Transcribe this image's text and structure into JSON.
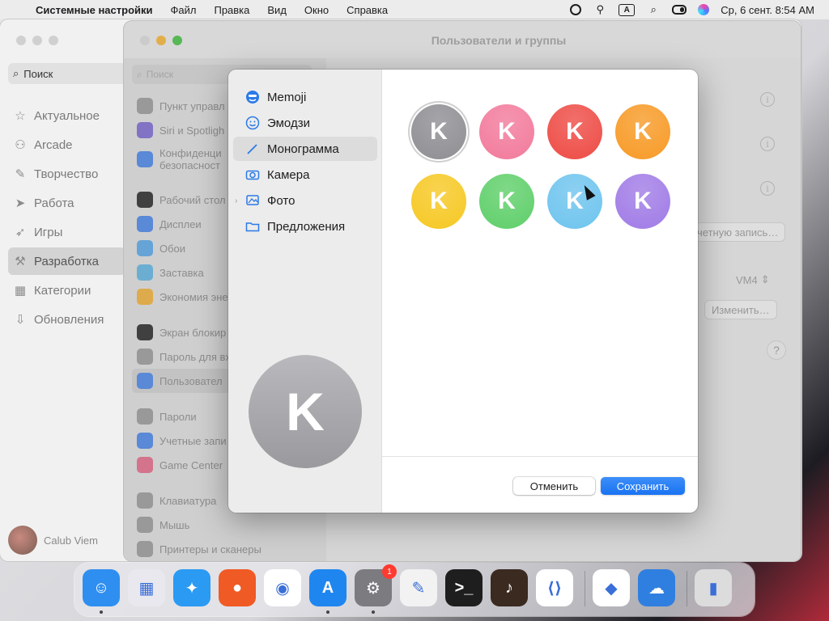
{
  "menubar": {
    "app_name": "Системные настройки",
    "menus": [
      "Файл",
      "Правка",
      "Вид",
      "Окно",
      "Справка"
    ],
    "input_source": "A",
    "clock": "Ср, 6 сент.  8:54 AM"
  },
  "appstore": {
    "search_label": "Поиск",
    "nav": [
      {
        "label": "Актуальное",
        "icon": "star-icon"
      },
      {
        "label": "Arcade",
        "icon": "joystick-icon"
      },
      {
        "label": "Творчество",
        "icon": "brush-icon"
      },
      {
        "label": "Работа",
        "icon": "paper-plane-icon"
      },
      {
        "label": "Игры",
        "icon": "rocket-icon"
      },
      {
        "label": "Разработка",
        "icon": "hammer-icon"
      },
      {
        "label": "Категории",
        "icon": "grid-icon"
      },
      {
        "label": "Обновления",
        "icon": "download-icon"
      }
    ],
    "active_index": 5,
    "user_name": "Calub Viem"
  },
  "settings": {
    "window_title": "Пользователи и группы",
    "search_placeholder": "Поиск",
    "groups": [
      [
        {
          "label": "Пункт управл",
          "color": "#9a9a9a"
        },
        {
          "label": "Siri и Spotligh",
          "color": "#7d6bd1"
        },
        {
          "label": "Конфиденци\nбезопасност",
          "color": "#4a86e8",
          "tall": true
        }
      ],
      [
        {
          "label": "Рабочий стол",
          "color": "#2b2b2b"
        },
        {
          "label": "Дисплеи",
          "color": "#4a86e8"
        },
        {
          "label": "Обои",
          "color": "#5aa8e8"
        },
        {
          "label": "Заставка",
          "color": "#62b5e0"
        },
        {
          "label": "Экономия эне",
          "color": "#f0b13a"
        }
      ],
      [
        {
          "label": "Экран блокир",
          "color": "#2b2b2b"
        },
        {
          "label": "Пароль для вх",
          "color": "#9a9a9a"
        },
        {
          "label": "Пользовател",
          "color": "#4a86e8",
          "selected": true
        }
      ],
      [
        {
          "label": "Пароли",
          "color": "#9a9a9a"
        },
        {
          "label": "Учетные запи",
          "color": "#4a86e8"
        },
        {
          "label": "Game Center",
          "color": "#e46b8a"
        }
      ],
      [
        {
          "label": "Клавиатура",
          "color": "#9a9a9a"
        },
        {
          "label": "Мышь",
          "color": "#9a9a9a"
        },
        {
          "label": "Принтеры и сканеры",
          "color": "#9a9a9a"
        }
      ]
    ],
    "account_button": "четную запись…",
    "vm_popup": "VM4",
    "change_button": "Изменить…",
    "help": "?"
  },
  "dialog": {
    "sources": [
      {
        "label": "Memoji",
        "icon": "memoji-icon"
      },
      {
        "label": "Эмодзи",
        "icon": "smiley-icon"
      },
      {
        "label": "Монограмма",
        "icon": "pencil-icon",
        "selected": true
      },
      {
        "label": "Камера",
        "icon": "camera-icon"
      },
      {
        "label": "Фото",
        "icon": "photos-icon",
        "expandable": true
      },
      {
        "label": "Предложения",
        "icon": "folder-icon"
      }
    ],
    "monogram_letter": "K",
    "monogram_colors": [
      "#8e8e93",
      "#f27a9b",
      "#ee4b45",
      "#f79a26",
      "#f6c823",
      "#5fcf6a",
      "#6ec4ee",
      "#a07be6"
    ],
    "selected_color_index": 0,
    "preview_letter": "K",
    "cancel_label": "Отменить",
    "save_label": "Сохранить"
  },
  "dock": {
    "apps": [
      {
        "name": "finder",
        "glyph": "☺",
        "bg": "#2f8ff0",
        "running": true
      },
      {
        "name": "launchpad",
        "glyph": "▦",
        "bg": "#e8e8ee",
        "running": false
      },
      {
        "name": "safari",
        "glyph": "✦",
        "bg": "#2b9af3",
        "running": false
      },
      {
        "name": "firefox",
        "glyph": "●",
        "bg": "#f05a24",
        "running": false
      },
      {
        "name": "chrome",
        "glyph": "◉",
        "bg": "#ffffff",
        "running": false
      },
      {
        "name": "app-store",
        "glyph": "A",
        "bg": "#1f86ef",
        "running": true
      },
      {
        "name": "system-settings",
        "glyph": "⚙",
        "bg": "#7b7b80",
        "running": true,
        "badge": "1"
      },
      {
        "name": "textedit",
        "glyph": "✎",
        "bg": "#f2f2f2",
        "running": false
      },
      {
        "name": "terminal",
        "glyph": ">_",
        "bg": "#1e1e1e",
        "running": false
      },
      {
        "name": "garageband",
        "glyph": "♪",
        "bg": "#3a2a20",
        "running": false
      },
      {
        "name": "vscode",
        "glyph": "⟨⟩",
        "bg": "#ffffff",
        "running": false
      },
      {
        "name": "visual-studio",
        "glyph": "◆",
        "bg": "#ffffff",
        "running": false
      },
      {
        "name": "weather",
        "glyph": "☁",
        "bg": "#2f7fe0",
        "running": false
      },
      {
        "name": "trash",
        "glyph": "▮",
        "bg": "#dcdcdc",
        "running": false
      }
    ]
  }
}
